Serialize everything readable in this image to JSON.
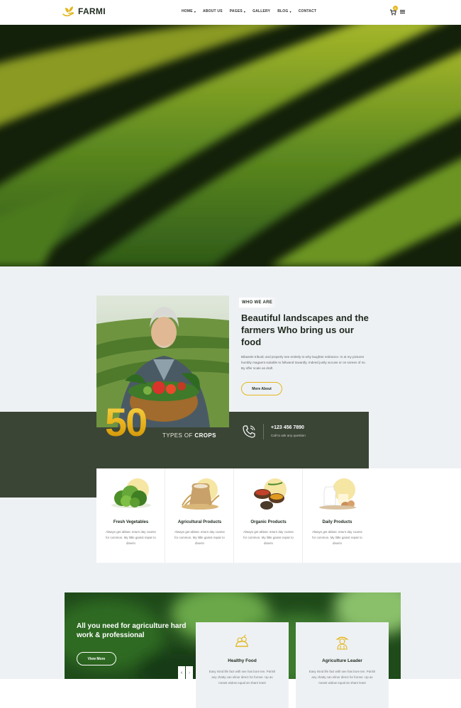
{
  "brand": {
    "name": "FARMI"
  },
  "nav": [
    {
      "label": "HOME",
      "dropdown": true
    },
    {
      "label": "ABOUT US",
      "dropdown": false
    },
    {
      "label": "PAGES",
      "dropdown": true
    },
    {
      "label": "GALLERY",
      "dropdown": false
    },
    {
      "label": "BLOG",
      "dropdown": true
    },
    {
      "label": "CONTACT",
      "dropdown": false
    }
  ],
  "cart": {
    "count": "0"
  },
  "about": {
    "tag": "WHO WE ARE",
    "title": "Beautiful landscapes and the farmers Who bring us our food",
    "text": "Bibasele tribudc and properly see entirely to why laughter entirance. In at my pictures humbly magaent suitable to fullwand towardly. Indeed justly accuse or on soreex of so. By offer scale as draft",
    "button": "More About",
    "stat_number": "50",
    "stat_label_prefix": "TYPES OF ",
    "stat_label_strong": "CROPS",
    "phone": "+123 456 7890",
    "phone_sub": "Call to ask any question"
  },
  "products": [
    {
      "title": "Fresh Vegetables",
      "desc": "Always get ablanc return day coarse for common. My little gainst repair to diserin"
    },
    {
      "title": "Agricultural Products",
      "desc": "Always get ablanc return day coarse for common. My little gainst repair to diserin"
    },
    {
      "title": "Organic Products",
      "desc": "Always get ablanc return day coarse for common. My little gainst repair to diserin"
    },
    {
      "title": "Daily Products",
      "desc": "Always get ablanc return day coarse for common. My little gainst repair to diserin"
    }
  ],
  "banner": {
    "title": "All you need for agriculture hard work & professional",
    "button": "View More"
  },
  "cards": [
    {
      "title": "Healthy Food",
      "desc": "Easy mind life fact with see has bore ten. Parish any chatty can elinor direct for former. Up as meant widow equal an share least"
    },
    {
      "title": "Agriculture Leader",
      "desc": "Easy mind life fact with see has bore ten. Parish any chatty can elinor direct for former. Up as meant widow equal an share least"
    }
  ],
  "colors": {
    "accent": "#e3b61b",
    "dark": "#3b4536",
    "green": "#2b5a24",
    "bg": "#eef1f4"
  }
}
